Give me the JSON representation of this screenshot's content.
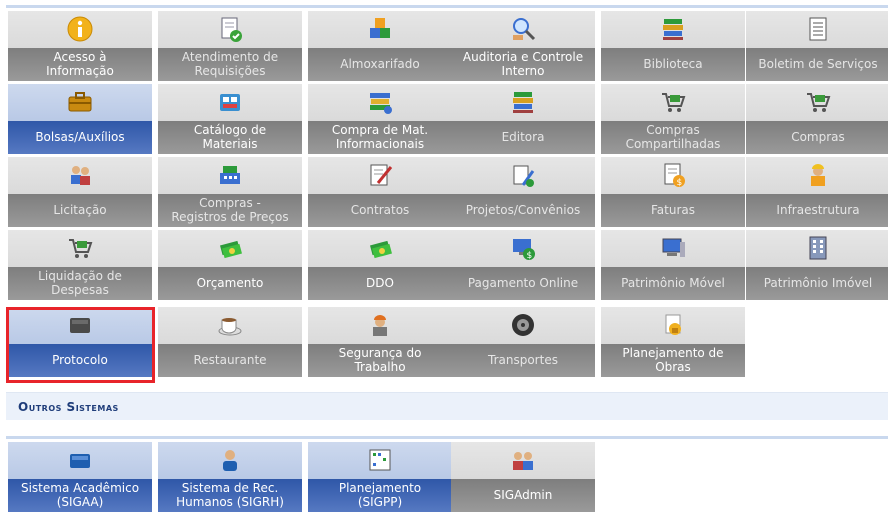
{
  "modules": [
    {
      "label": "Acesso à\nInformação",
      "icon": "info-icon",
      "style": "gray"
    },
    {
      "label": "Atendimento de\nRequisições",
      "icon": "document-check-icon",
      "style": "gray",
      "dim": true
    },
    {
      "label": "Almoxarifado",
      "icon": "boxes-icon",
      "style": "gray",
      "dim": true
    },
    {
      "label": "Auditoria e Controle\nInterno",
      "icon": "magnifier-icon",
      "style": "gray"
    },
    {
      "label": "Biblioteca",
      "icon": "books-icon",
      "style": "gray",
      "dim": true
    },
    {
      "label": "Boletim de Serviços",
      "icon": "bulletin-icon",
      "style": "gray",
      "dim": true
    },
    {
      "label": "Bolsas/Auxílios",
      "icon": "briefcase-icon",
      "style": "blue"
    },
    {
      "label": "Catálogo de\nMateriais",
      "icon": "catalog-icon",
      "style": "gray"
    },
    {
      "label": "Compra de Mat.\nInformacionais",
      "icon": "books-stack-icon",
      "style": "gray"
    },
    {
      "label": "Editora",
      "icon": "books-icon",
      "style": "gray",
      "dim": true
    },
    {
      "label": "Compras\nCompartilhadas",
      "icon": "cart-icon",
      "style": "gray",
      "dim": true
    },
    {
      "label": "Compras",
      "icon": "cart-icon",
      "style": "gray",
      "dim": true
    },
    {
      "label": "Licitação",
      "icon": "people-icon",
      "style": "gray",
      "dim": true
    },
    {
      "label": "Compras -\nRegistros de Preços",
      "icon": "cash-register-icon",
      "style": "gray",
      "dim": true
    },
    {
      "label": "Contratos",
      "icon": "contract-pen-icon",
      "style": "gray",
      "dim": true
    },
    {
      "label": "Projetos/Convênios",
      "icon": "tools-icon",
      "style": "gray",
      "dim": true
    },
    {
      "label": "Faturas",
      "icon": "invoice-icon",
      "style": "gray",
      "dim": true
    },
    {
      "label": "Infraestrutura",
      "icon": "worker-icon",
      "style": "gray",
      "dim": true
    },
    {
      "label": "Liquidação de\nDespesas",
      "icon": "cart-icon",
      "style": "gray",
      "dim": true
    },
    {
      "label": "Orçamento",
      "icon": "money-icon",
      "style": "gray"
    },
    {
      "label": "DDO",
      "icon": "money-icon",
      "style": "gray"
    },
    {
      "label": "Pagamento Online",
      "icon": "online-payment-icon",
      "style": "gray",
      "dim": true
    },
    {
      "label": "Patrimônio Móvel",
      "icon": "computer-icon",
      "style": "gray",
      "dim": true
    },
    {
      "label": "Patrimônio Imóvel",
      "icon": "building-icon",
      "style": "gray",
      "dim": true
    },
    {
      "label": "Protocolo",
      "icon": "book-icon",
      "style": "blue"
    },
    {
      "label": "Restaurante",
      "icon": "coffee-cup-icon",
      "style": "gray",
      "dim": true
    },
    {
      "label": "Segurança do\nTrabalho",
      "icon": "safety-worker-icon",
      "style": "gray"
    },
    {
      "label": "Transportes",
      "icon": "wheel-icon",
      "style": "gray",
      "dim": true
    },
    {
      "label": "Planejamento de\nObras",
      "icon": "construction-icon",
      "style": "gray"
    }
  ],
  "other_systems": {
    "title": "Outros Sistemas",
    "items": [
      {
        "label": "Sistema Acadêmico\n(SIGAA)",
        "icon": "academic-book-icon",
        "style": "blue"
      },
      {
        "label": "Sistema de Rec.\nHumanos (SIGRH)",
        "icon": "person-icon",
        "style": "blue"
      },
      {
        "label": "Planejamento\n(SIGPP)",
        "icon": "planning-chart-icon",
        "style": "blue"
      },
      {
        "label": "SIGAdmin",
        "icon": "admin-users-icon",
        "style": "gray"
      }
    ]
  },
  "colors": {
    "highlight": "#e8242a",
    "blue_tile": "#2f57a8",
    "gray_tile": "#7e7e7e"
  }
}
